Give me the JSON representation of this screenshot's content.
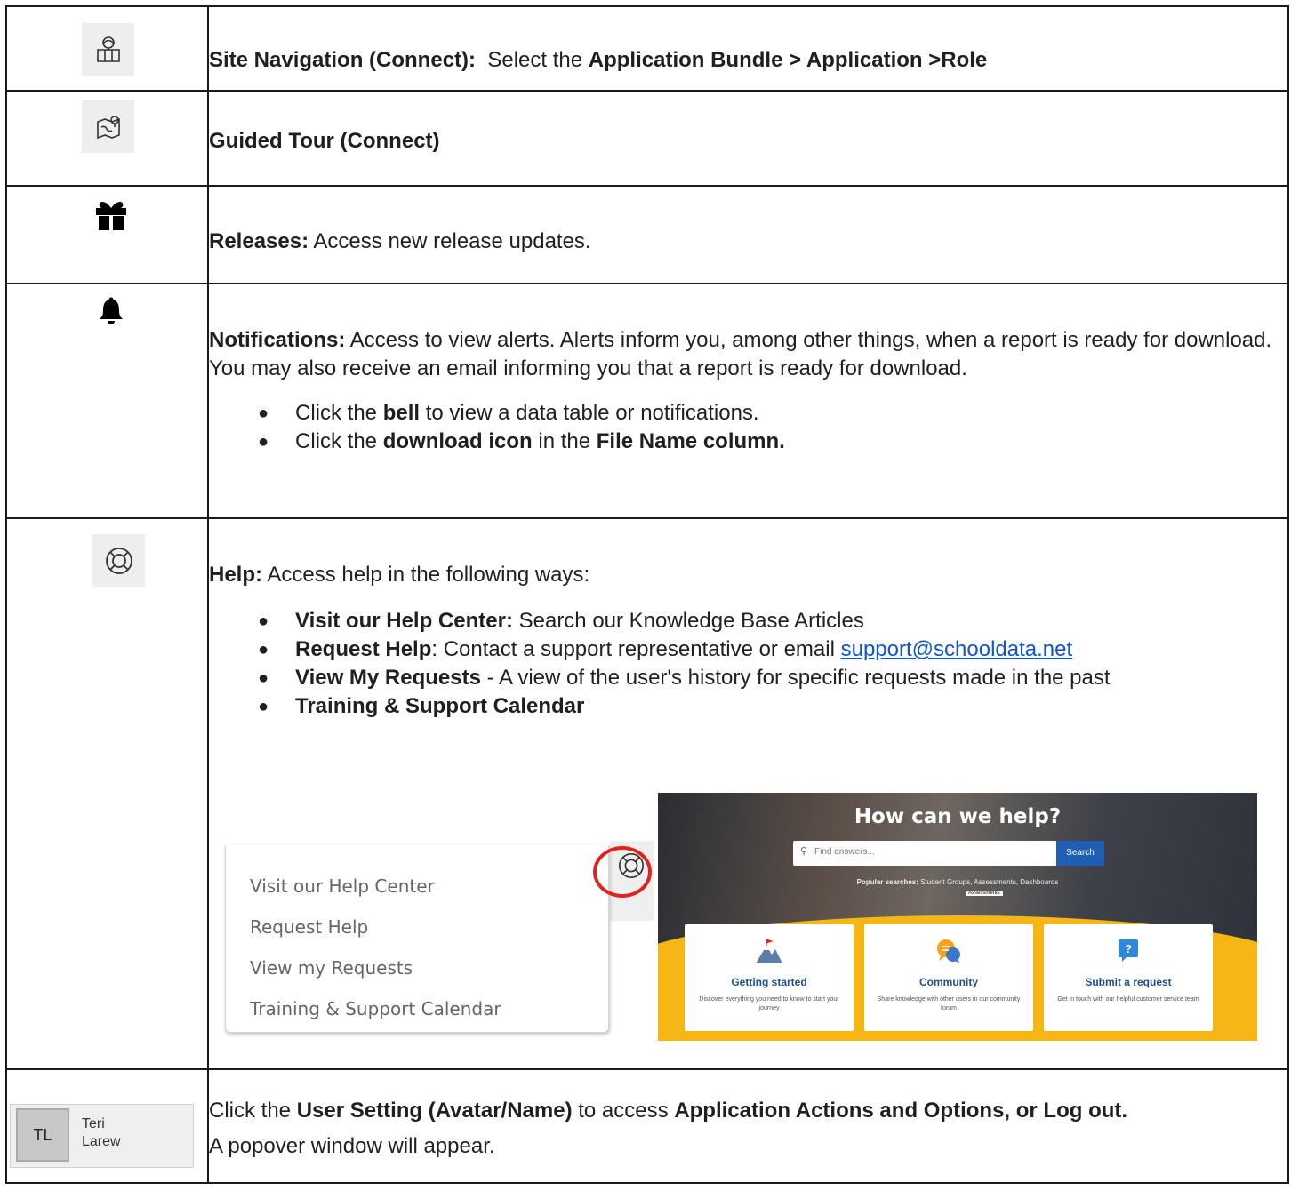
{
  "rows": [
    {
      "icon": "site-navigation-icon",
      "label": "Site Navigation (Connect):",
      "text": "Select the",
      "em": "Application Bundle > Application >Role"
    },
    {
      "icon": "guided-tour-icon",
      "label": "Guided Tour (Connect)"
    },
    {
      "icon": "gift-icon",
      "label": "Releases:",
      "text": "Access new release updates."
    },
    {
      "icon": "bell-icon",
      "label": "Notifications:",
      "text": "Access to view alerts. Alerts inform you, among other things, when a report is ready for download. You may also receive an email informing you that a report is ready for download.",
      "b1_pre": "Click the",
      "b1_bold": "bell",
      "b1_post": "to view a data table or notifications.",
      "b2_pre": "Click the",
      "b2_bold": "download icon",
      "b2_mid": "in the",
      "b2_bold2": "File Name column."
    },
    {
      "icon": "help-icon",
      "label": "Help:",
      "text": "Access help in the following ways:",
      "b1_bold": "Visit our Help Center:",
      "b1_post": "Search our Knowledge Base Articles",
      "b2_bold": "Request Help",
      "b2_post": ": Contact a support representative or email",
      "b2_link": "support@schooldata.net",
      "b3_bold": "View My Requests",
      "b3_post": " - A view of the user's history for specific requests made in the past",
      "b4_bold": "Training & Support Calendar"
    },
    {
      "icon": "avatar-icon",
      "pre": "Click the",
      "bold1": "User Setting (Avatar/Name)",
      "mid": "to access",
      "bold2": "Application Actions and Options, or Log out.",
      "line2": "A popover window will appear."
    }
  ],
  "help_menu": {
    "items": [
      "Visit our Help Center",
      "Request Help",
      "View my Requests",
      "Training & Support Calendar"
    ]
  },
  "help_center": {
    "title": "How can we help?",
    "search_placeholder": "Find answers...",
    "search_button": "Search",
    "popular_label": "Popular searches:",
    "popular_items": "Student Groups, Assessments, Dashboards",
    "tag": "Assessments",
    "cards": [
      {
        "title": "Getting started",
        "desc": "Discover everything you need to know to start your journey"
      },
      {
        "title": "Community",
        "desc": "Share knowledge with other users in our community forum"
      },
      {
        "title": "Submit a request",
        "desc": "Get in touch with our helpful customer service team"
      }
    ]
  },
  "avatar": {
    "initials": "TL",
    "first": "Teri",
    "last": "Larew"
  },
  "colors": {
    "link": "#1155cc",
    "accent_red": "#e0241d",
    "help_yellow": "#f6b716",
    "search_blue": "#1f5fb3"
  }
}
